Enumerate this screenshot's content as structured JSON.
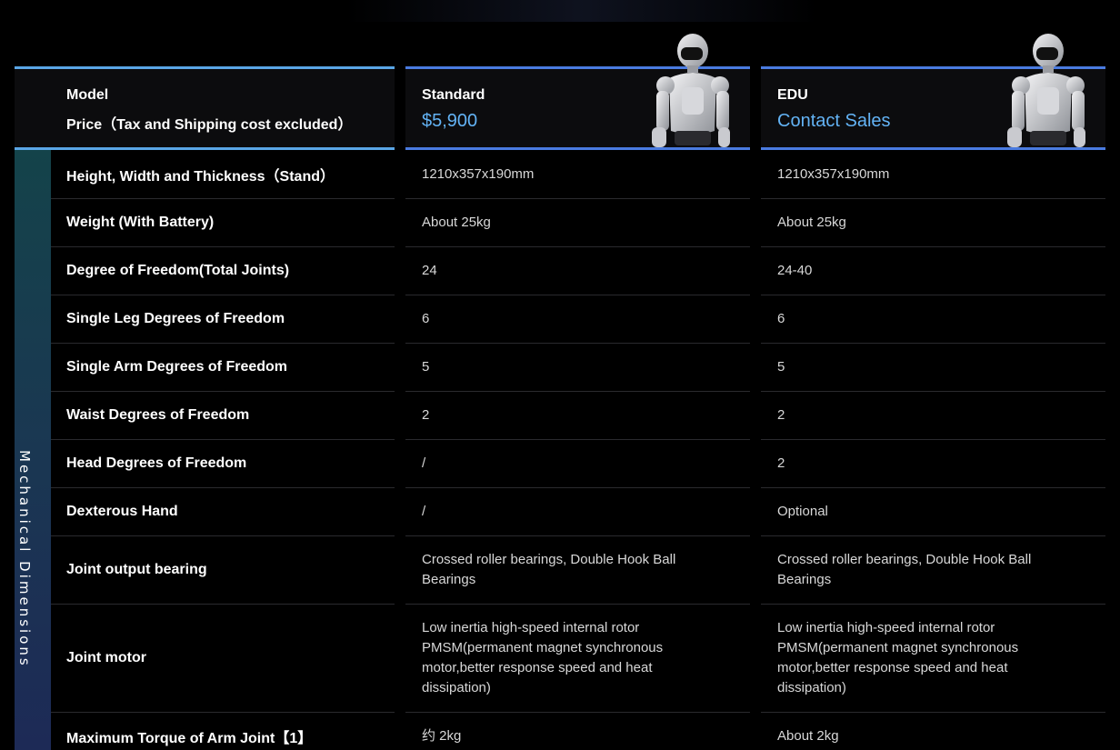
{
  "header": {
    "model_label": "Model",
    "price_label": "Price（Tax and Shipping cost excluded）",
    "plans": [
      {
        "name": "Standard",
        "price": "$5,900"
      },
      {
        "name": "EDU",
        "price": "Contact Sales"
      }
    ]
  },
  "category": "Mechanical Dimensions",
  "colors": {
    "accent": "#63b3f5",
    "header_border": "#4a7be0",
    "band_top": "#14434a",
    "band_bottom": "#1d2a56"
  },
  "rows": [
    {
      "label": "Height, Width and Thickness（Stand）",
      "standard": "1210x357x190mm",
      "edu": "1210x357x190mm"
    },
    {
      "label": "Weight (With Battery)",
      "standard": "About 25kg",
      "edu": "About 25kg"
    },
    {
      "label": "Degree of Freedom(Total Joints)",
      "standard": "24",
      "edu": "24-40"
    },
    {
      "label": "Single Leg Degrees of Freedom",
      "standard": "6",
      "edu": "6"
    },
    {
      "label": "Single Arm Degrees of Freedom",
      "standard": "5",
      "edu": "5"
    },
    {
      "label": "Waist Degrees of Freedom",
      "standard": "2",
      "edu": "2"
    },
    {
      "label": "Head Degrees of Freedom",
      "standard": "/",
      "edu": "2"
    },
    {
      "label": "Dexterous Hand",
      "standard": "/",
      "edu": "Optional"
    },
    {
      "label": "Joint output bearing",
      "standard": "Crossed roller bearings, Double Hook Ball Bearings",
      "edu": "Crossed roller bearings, Double Hook Ball Bearings"
    },
    {
      "label": "Joint motor",
      "standard": "Low inertia high-speed internal rotor PMSM(permanent magnet synchronous motor,better response speed and heat dissipation)",
      "edu": "Low inertia high-speed internal rotor PMSM(permanent magnet synchronous motor,better response speed and heat dissipation)"
    },
    {
      "label": "Maximum Torque of Arm Joint【1】",
      "standard": "约 2kg",
      "edu": "About 2kg"
    }
  ]
}
